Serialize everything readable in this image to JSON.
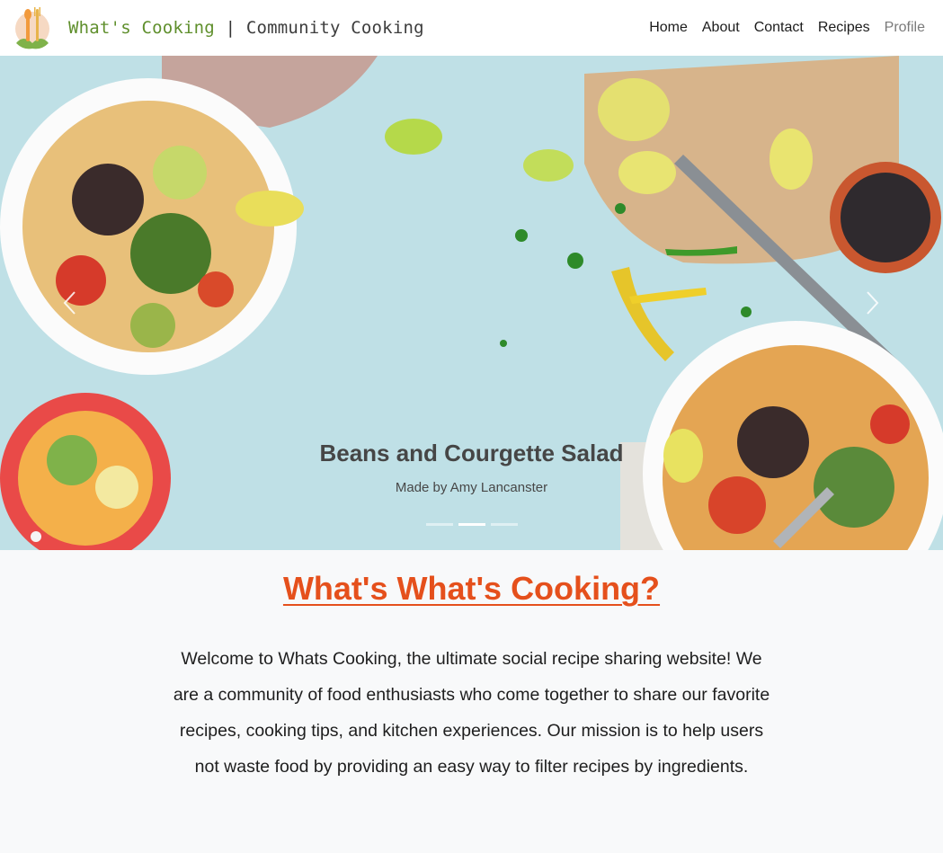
{
  "brand": {
    "name": "What's Cooking",
    "separator": "|",
    "tagline": "Community Cooking",
    "logo_icon": "fork-spoon-leaf-logo"
  },
  "nav": {
    "items": [
      {
        "label": "Home"
      },
      {
        "label": "About"
      },
      {
        "label": "Contact"
      },
      {
        "label": "Recipes"
      },
      {
        "label": "Profile"
      }
    ]
  },
  "carousel": {
    "slide_title": "Beans and Courgette Salad",
    "slide_subtitle": "Made by Amy Lancanster",
    "prev_icon": "chevron-left-icon",
    "next_icon": "chevron-right-icon",
    "indicator_count": 3,
    "active_indicator": 2
  },
  "intro": {
    "heading": "What's What's Cooking?",
    "body": "Welcome to Whats Cooking, the ultimate social recipe sharing website! We are a community of food enthusiasts who come together to share our favorite recipes, cooking tips, and kitchen experiences. Our mission is to help users not waste food by providing an easy way to filter recipes by ingredients."
  },
  "colors": {
    "accent": "#e5501c",
    "brand_green": "#5f8f2c",
    "hero_background": "#bcdde3"
  }
}
